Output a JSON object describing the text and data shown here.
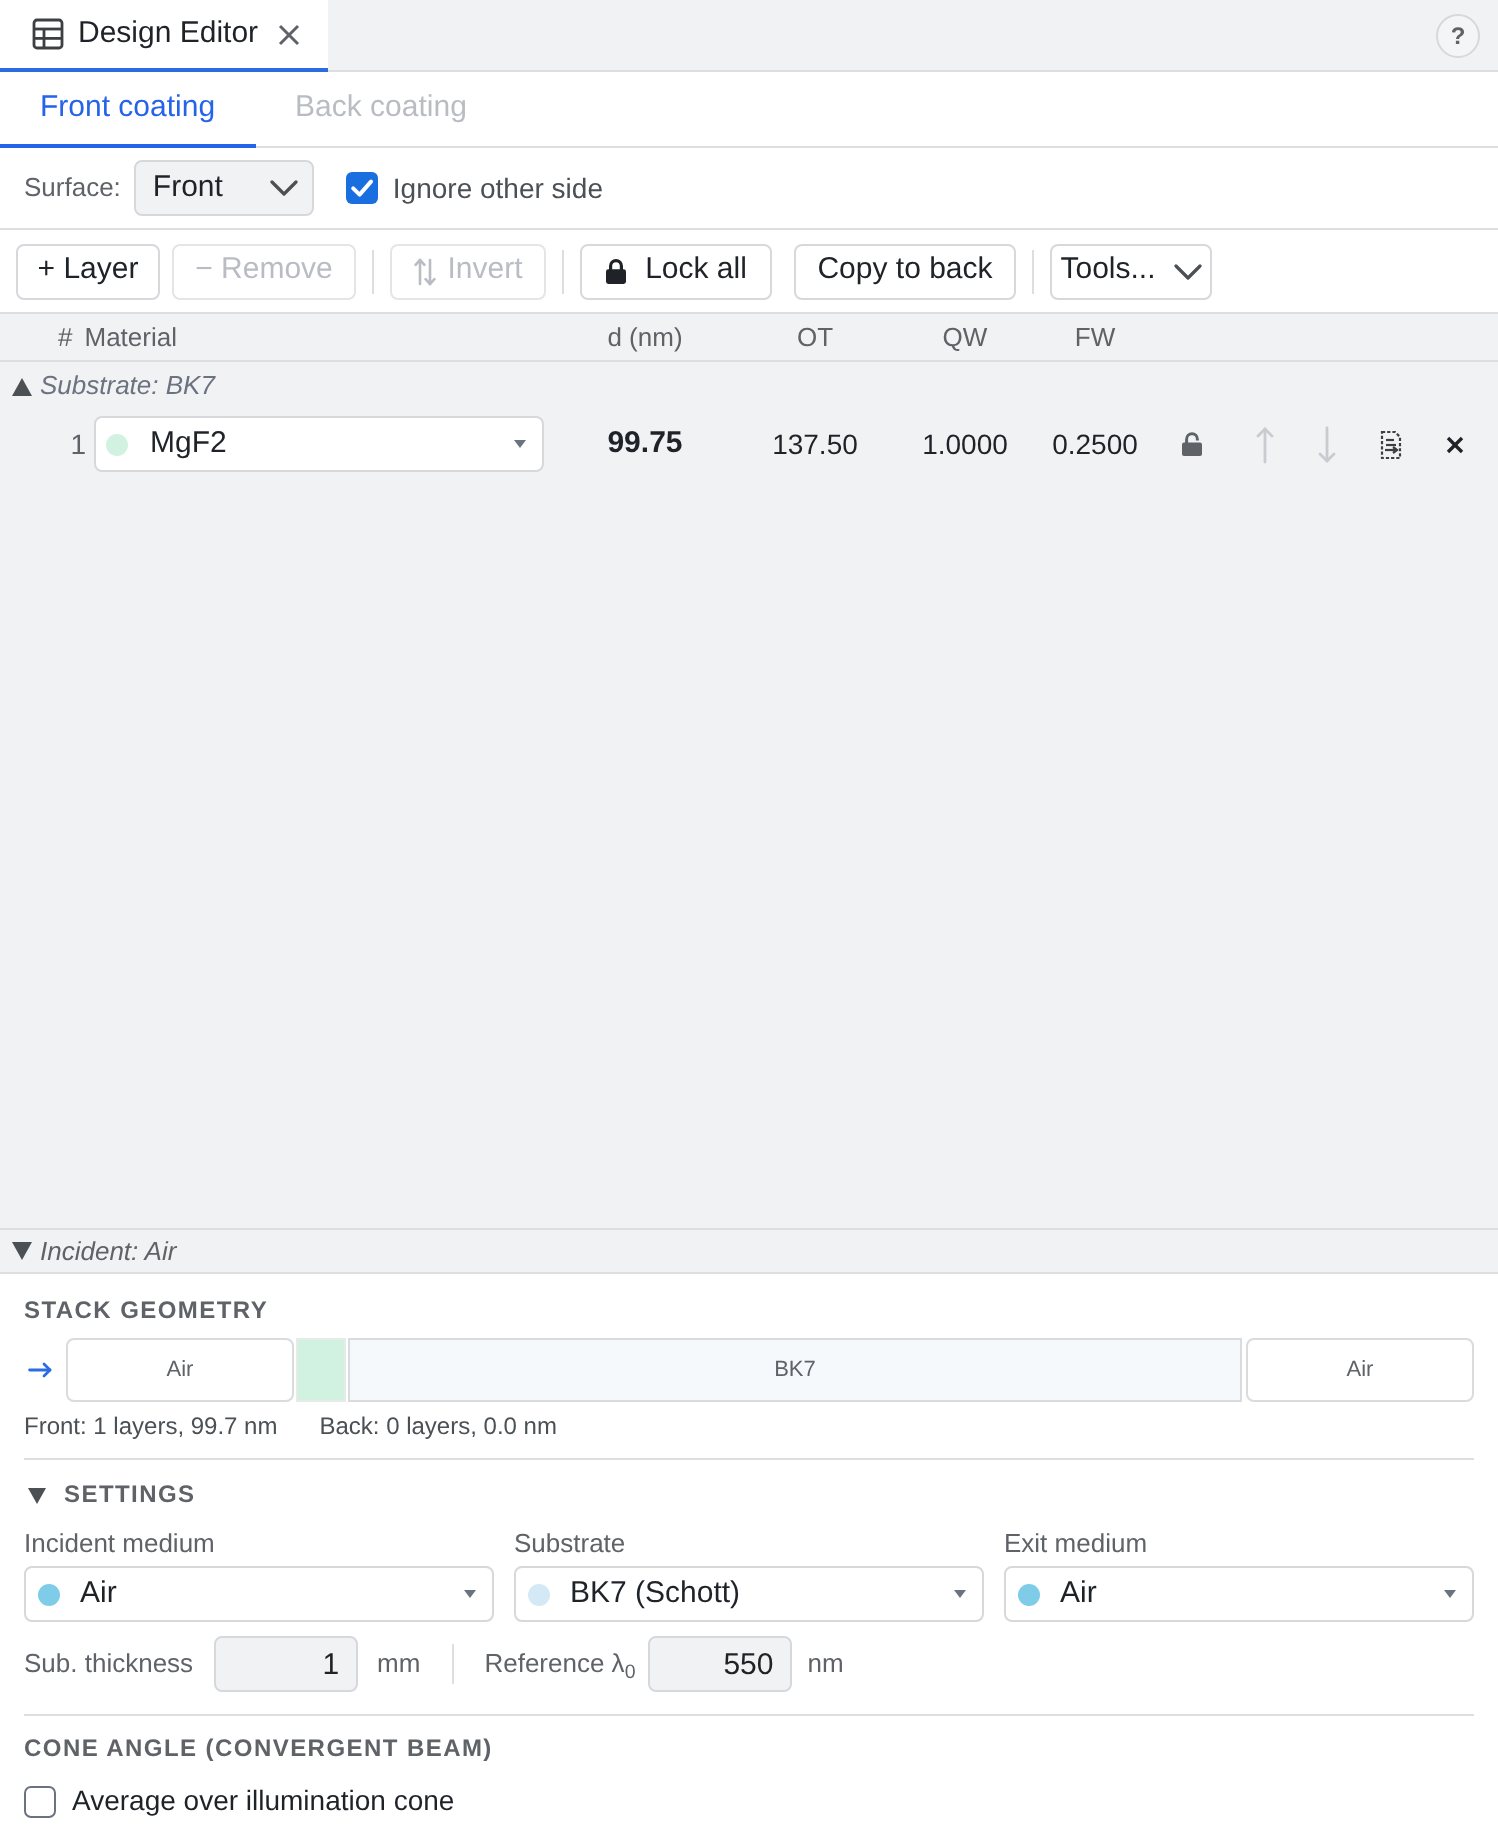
{
  "window_tabs": [
    {
      "label": "Design Editor",
      "selected": true
    }
  ],
  "help_button": {
    "label": "?"
  },
  "coating_tabs": [
    {
      "label": "Front coating",
      "selected": true,
      "disabled": false
    },
    {
      "label": "Back coating",
      "selected": false,
      "disabled": true
    }
  ],
  "surface_bar": {
    "surface": {
      "label": "Surface:",
      "value": "Front"
    },
    "ignore_other_side": {
      "label": "Ignore other side",
      "checked": true
    }
  },
  "toolbar": {
    "add_layer": {
      "label": "+ Layer",
      "disabled": false
    },
    "remove": {
      "label": "− Remove",
      "disabled": true
    },
    "invert": {
      "label": "Invert",
      "disabled": true
    },
    "lock_all": {
      "label": "Lock all",
      "disabled": false
    },
    "copy_to_back": {
      "label": "Copy to back",
      "disabled": false
    },
    "tools": {
      "label": "Tools...",
      "disabled": false
    }
  },
  "table": {
    "columns": [
      "#",
      "Material",
      "d (nm)",
      "OT",
      "QW",
      "FW"
    ],
    "substrate": {
      "label": "Substrate: BK7"
    },
    "layers": [
      {
        "number": "1",
        "material": "MgF2",
        "color": "#d1f2e1",
        "thickness": "99.75",
        "ot": "137.50",
        "qw": "1.0000",
        "fw": "0.2500",
        "locked": false,
        "move_up_disabled": true,
        "move_down_disabled": true
      }
    ],
    "incident": {
      "label": "Incident: Air"
    }
  },
  "stack_geometry": {
    "title": "STACK GEOMETRY",
    "segments": [
      {
        "kind": "medium",
        "label": "Air",
        "color": "#ffffff"
      },
      {
        "kind": "layer",
        "color": "#d1f2e1"
      },
      {
        "kind": "substrate",
        "label": "BK7",
        "color": "#f5f9fc"
      },
      {
        "kind": "medium",
        "label": "Air",
        "color": "#ffffff"
      }
    ],
    "front_summary": "Front: 1 layers, 99.7 nm",
    "back_summary": "Back: 0 layers, 0.0 nm"
  },
  "settings": {
    "title": "SETTINGS",
    "expanded": true,
    "media": [
      {
        "label": "Incident medium",
        "value": "Air",
        "color": "#7fcce9"
      },
      {
        "label": "Substrate",
        "value": "BK7 (Schott)",
        "color": "#d4e8f6"
      },
      {
        "label": "Exit medium",
        "value": "Air",
        "color": "#7fcce9"
      }
    ],
    "sub_thickness": {
      "label": "Sub. thickness",
      "value": "1",
      "unit": "mm"
    },
    "reference_wavelength": {
      "label": "Reference λ$_{0}$",
      "value": "550",
      "unit": "nm"
    }
  },
  "cone_angle": {
    "title": "CONE ANGLE (CONVERGENT BEAM)",
    "average_over_cone": {
      "label": "Average over illumination cone",
      "checked": false
    }
  }
}
